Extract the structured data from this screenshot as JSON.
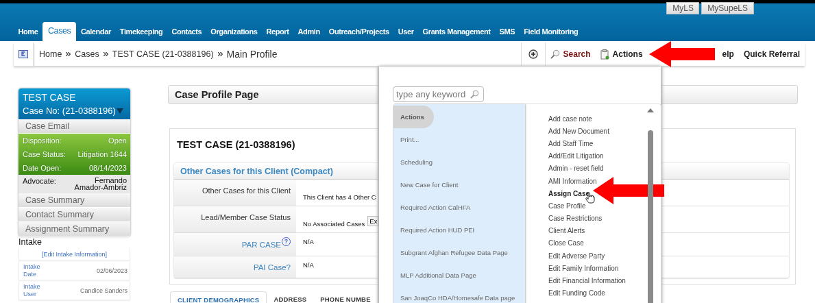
{
  "top_buttons": [
    "MyLS",
    "MySupeLS"
  ],
  "nav_tabs": [
    {
      "label": "Home",
      "selected": false
    },
    {
      "label": "Cases",
      "selected": true
    },
    {
      "label": "Calendar",
      "selected": false
    },
    {
      "label": "Timekeeping",
      "selected": false
    },
    {
      "label": "Contacts",
      "selected": false
    },
    {
      "label": "Organizations",
      "selected": false
    },
    {
      "label": "Report",
      "selected": false
    },
    {
      "label": "Admin",
      "selected": false
    },
    {
      "label": "Outreach/Projects",
      "selected": false
    },
    {
      "label": "User",
      "selected": false
    },
    {
      "label": "Grants Management",
      "selected": false
    },
    {
      "label": "SMS",
      "selected": false
    },
    {
      "label": "Field Monitoring",
      "selected": false
    }
  ],
  "breadcrumb": {
    "items": [
      "Home",
      "Cases",
      "TEST CASE (21-0388196)"
    ],
    "current": "Main Profile"
  },
  "toolbar": {
    "search": "Search",
    "actions": "Actions",
    "help": "elp",
    "quick_referral": "Quick Referral"
  },
  "case_card": {
    "title": "TEST CASE",
    "case_no": "Case No: (21-0388196)",
    "email": "Case Email",
    "status_rows": [
      {
        "label": "Disposition:",
        "value": "Open"
      },
      {
        "label": "Case Status:",
        "value": "Litigation 1644"
      },
      {
        "label": "Date Open:",
        "value": "08/14/2023"
      }
    ],
    "advocate": {
      "label": "Advocate:",
      "value": "Fernando Amador-Ambriz"
    },
    "links": [
      "Case Summary",
      "Contact Summary",
      "Assignment Summary"
    ]
  },
  "intake": {
    "title": "Intake",
    "edit_link": "[Edit Intake Information]",
    "rows": [
      {
        "label": "Intake Date",
        "value": "02/06/2023"
      },
      {
        "label": "Intake User",
        "value": "Candice Sanders"
      }
    ]
  },
  "page_title": "Case Profile Page",
  "case_heading": "TEST CASE (21-0388196)",
  "other_cases": {
    "title": "Other Cases for this Client (Compact)",
    "rows": [
      {
        "label": "Other Cases for this Client",
        "link": false,
        "value": "This Client has 4 Other C"
      },
      {
        "label": "Lead/Member Case Status",
        "link": false,
        "value": "No Associated Cases",
        "button": "Ex"
      },
      {
        "label": "PAR CASE",
        "link": true,
        "help_mark": "?",
        "value": "N/A"
      },
      {
        "label": "PAI Case?",
        "link": true,
        "value": "N/A"
      }
    ]
  },
  "bottom_tabs": [
    {
      "label": "CLIENT DEMOGRAPHICS",
      "selected": true
    },
    {
      "label": "ADDRESS",
      "selected": false
    },
    {
      "label": "PHONE NUMBE",
      "selected": false
    }
  ],
  "actions_popup": {
    "placeholder": "type any keyword",
    "categories": [
      {
        "label": "Actions",
        "selected": true
      },
      {
        "label": "Print...",
        "selected": false
      },
      {
        "label": "Scheduling",
        "selected": false
      },
      {
        "label": "New Case for Client",
        "selected": false
      },
      {
        "label": "Required Action CalHFA",
        "selected": false
      },
      {
        "label": "Required Action HUD PEI",
        "selected": false
      },
      {
        "label": "Subgrant Afghan Refugee Data Page",
        "selected": false
      },
      {
        "label": "MLP Additional Data Page",
        "selected": false
      },
      {
        "label": "San JoaqCo HDA/Homesafe Data page",
        "selected": false
      }
    ],
    "items": [
      {
        "label": "Add case note",
        "hovered": false
      },
      {
        "label": "Add New Document",
        "hovered": false
      },
      {
        "label": "Add Staff Time",
        "hovered": false
      },
      {
        "label": "Add/Edit Litigation",
        "hovered": false
      },
      {
        "label": "Admin - reset field",
        "hovered": false
      },
      {
        "label": "AMI Information",
        "hovered": false
      },
      {
        "label": "Assign Case",
        "hovered": true
      },
      {
        "label": "Case Profile",
        "hovered": false
      },
      {
        "label": "Case Restrictions",
        "hovered": false
      },
      {
        "label": "Client Alerts",
        "hovered": false
      },
      {
        "label": "Close Case",
        "hovered": false
      },
      {
        "label": "Edit Adverse Party",
        "hovered": false
      },
      {
        "label": "Edit Family Information",
        "hovered": false
      },
      {
        "label": "Edit Financial Information",
        "hovered": false
      },
      {
        "label": "Edit Funding Code",
        "hovered": false
      }
    ]
  }
}
